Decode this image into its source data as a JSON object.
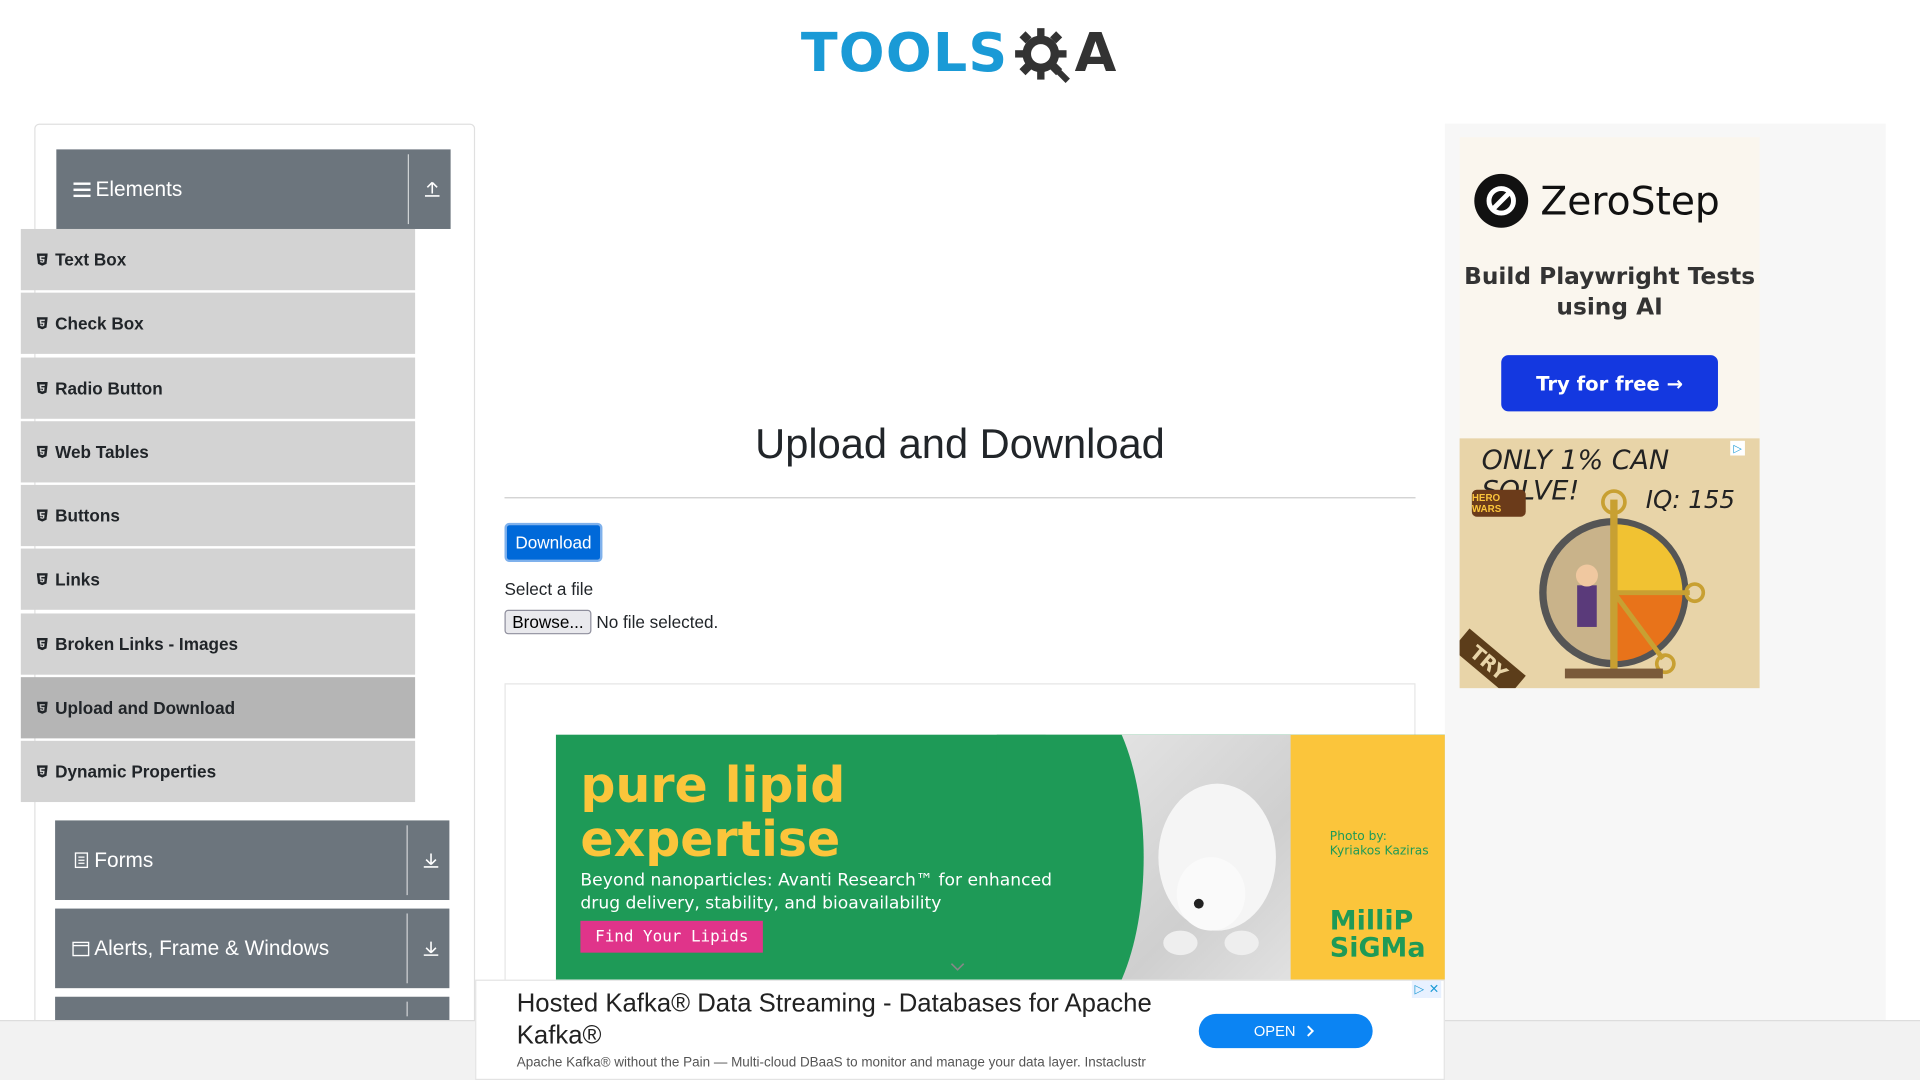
{
  "header": {
    "logo_primary": "TOOLS",
    "logo_secondary": "QA"
  },
  "sidebar": {
    "groups": [
      {
        "label": "Elements",
        "icon": "hamburger-icon",
        "toggle_icon": "collapse-up-icon",
        "expanded": true
      },
      {
        "label": "Forms",
        "icon": "form-icon",
        "toggle_icon": "expand-down-icon",
        "expanded": false
      },
      {
        "label": "Alerts, Frame & Windows",
        "icon": "window-icon",
        "toggle_icon": "expand-down-icon",
        "expanded": false
      }
    ],
    "items": [
      {
        "label": "Text Box",
        "icon": "html5-icon"
      },
      {
        "label": "Check Box",
        "icon": "html5-icon"
      },
      {
        "label": "Radio Button",
        "icon": "html5-icon"
      },
      {
        "label": "Web Tables",
        "icon": "html5-icon"
      },
      {
        "label": "Buttons",
        "icon": "html5-icon"
      },
      {
        "label": "Links",
        "icon": "html5-icon"
      },
      {
        "label": "Broken Links - Images",
        "icon": "html5-icon"
      },
      {
        "label": "Upload and Download",
        "icon": "html5-icon",
        "active": true
      },
      {
        "label": "Dynamic Properties",
        "icon": "html5-icon"
      }
    ]
  },
  "main": {
    "title": "Upload and Download",
    "download_label": "Download",
    "file_label": "Select a file",
    "browse_label": "Browse...",
    "file_status": "No file selected."
  },
  "ads": {
    "lipid": {
      "headline": "pure lipid expertise",
      "subtext": "Beyond nanoparticles: Avanti Research™ for enhanced drug delivery, stability, and bioavailability",
      "cta": "Find Your Lipids",
      "credit_line1": "Photo by:",
      "credit_line2": "Kyriakos Kaziras",
      "brand_line1": "MilliP",
      "brand_line2": "SiGMa"
    },
    "zerostep": {
      "brand": "ZeroStep",
      "tagline": "Build Playwright Tests using AI",
      "cta": "Try for free →"
    },
    "iq": {
      "headline": "ONLY 1% CAN SOLVE!",
      "score": "IQ: 155",
      "brand": "HERO WARS",
      "try_label": "TRY"
    },
    "kafka": {
      "title": "Hosted Kafka® Data Streaming - Databases for Apache Kafka®",
      "description": "Apache Kafka® without the Pain — Multi-cloud DBaaS to monitor and manage your data layer. Instaclustr",
      "cta": "OPEN",
      "adchoice_glyph": "▷",
      "close_glyph": "✕"
    }
  },
  "colors": {
    "brand_blue": "#1a9ad6",
    "sidebar_header": "#6c757d",
    "sidebar_item": "#d3d3d3",
    "sidebar_item_active": "#b5b5b5",
    "primary_button": "#0069d9"
  }
}
